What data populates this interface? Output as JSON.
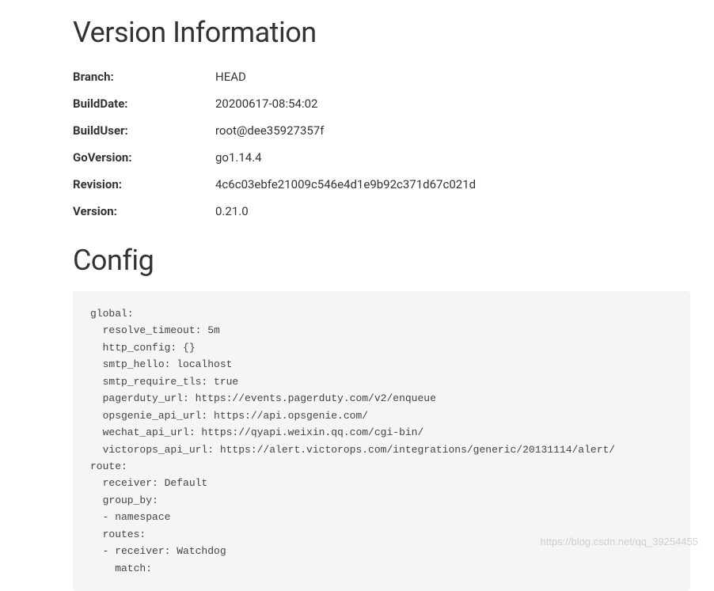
{
  "headings": {
    "version_info": "Version Information",
    "config": "Config"
  },
  "version": {
    "rows": [
      {
        "label": "Branch:",
        "value": "HEAD"
      },
      {
        "label": "BuildDate:",
        "value": "20200617-08:54:02"
      },
      {
        "label": "BuildUser:",
        "value": "root@dee35927357f"
      },
      {
        "label": "GoVersion:",
        "value": "go1.14.4"
      },
      {
        "label": "Revision:",
        "value": "4c6c03ebfe21009c546e4d1e9b92c371d67c021d"
      },
      {
        "label": "Version:",
        "value": "0.21.0"
      }
    ]
  },
  "config_text": "global:\n  resolve_timeout: 5m\n  http_config: {}\n  smtp_hello: localhost\n  smtp_require_tls: true\n  pagerduty_url: https://events.pagerduty.com/v2/enqueue\n  opsgenie_api_url: https://api.opsgenie.com/\n  wechat_api_url: https://qyapi.weixin.qq.com/cgi-bin/\n  victorops_api_url: https://alert.victorops.com/integrations/generic/20131114/alert/\nroute:\n  receiver: Default\n  group_by:\n  - namespace\n  routes:\n  - receiver: Watchdog\n    match:",
  "watermark": "https://blog.csdn.net/qq_39254455"
}
